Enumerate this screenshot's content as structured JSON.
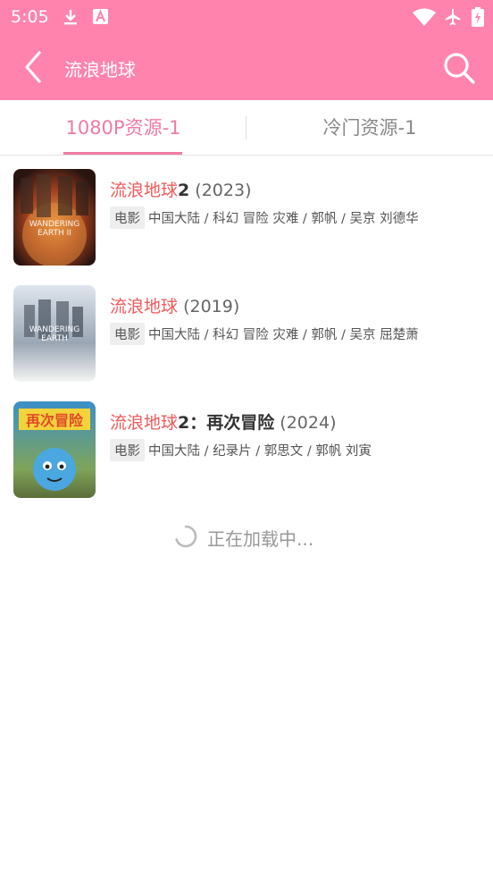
{
  "status_bar": {
    "time": "5:05",
    "icons": [
      "download-icon",
      "a-notification-icon",
      "wifi-icon",
      "airplane-icon",
      "battery-icon"
    ]
  },
  "toolbar": {
    "title": "流浪地球",
    "back_icon": "back-arrow-icon",
    "search_icon": "search-icon"
  },
  "colors": {
    "brand": "#ff83ad",
    "accent": "#f07ba2",
    "highlight": "#ef5a5a"
  },
  "tabs": [
    {
      "label": "1080P资源-1",
      "selected": true
    },
    {
      "label": "冷门资源-1",
      "selected": false
    }
  ],
  "results": [
    {
      "title_highlight": "流浪地球",
      "title_rest": "2",
      "year": "(2023)",
      "tag": "电影",
      "meta": "中国大陆 / 科幻 冒险 灾难 / 郭帆 / 吴京 刘德华"
    },
    {
      "title_highlight": "流浪地球",
      "title_rest": "",
      "year": "(2019)",
      "tag": "电影",
      "meta": "中国大陆 / 科幻 冒险 灾难 / 郭帆 / 吴京 屈楚萧"
    },
    {
      "title_highlight": "流浪地球",
      "title_rest": "2：再次冒险",
      "year": "(2024)",
      "tag": "电影",
      "meta": "中国大陆 / 纪录片 / 郭思文 / 郭帆 刘寅"
    }
  ],
  "loading_text": "正在加载中..."
}
